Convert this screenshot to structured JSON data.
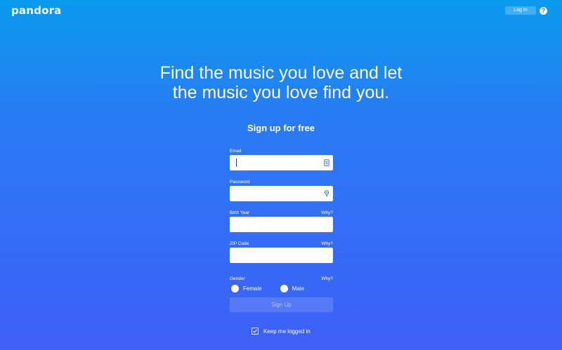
{
  "header": {
    "logo": "pandora",
    "login_label": "Log In",
    "help_glyph": "?"
  },
  "hero": {
    "line1": "Find the music you love and let",
    "line2": "the music you love find you."
  },
  "form": {
    "title": "Sign up for free",
    "email": {
      "label": "Email",
      "value": ""
    },
    "password": {
      "label": "Password",
      "value": ""
    },
    "birth_year": {
      "label": "Birth Year",
      "why": "Why?",
      "value": ""
    },
    "zip": {
      "label": "ZIP Code",
      "why": "Why?",
      "value": ""
    },
    "gender": {
      "label": "Gender",
      "why": "Why?",
      "options": [
        "Female",
        "Male"
      ]
    },
    "submit_label": "Sign Up",
    "keep_logged_in_label": "Keep me logged in"
  },
  "icons": {
    "help": "help-icon",
    "email_field": "contact-card-icon",
    "password_field": "key-icon",
    "checkbox": "checkmark-icon"
  },
  "colors": {
    "background_top": "#0a9aee",
    "background_bottom": "#3f5ff7"
  }
}
